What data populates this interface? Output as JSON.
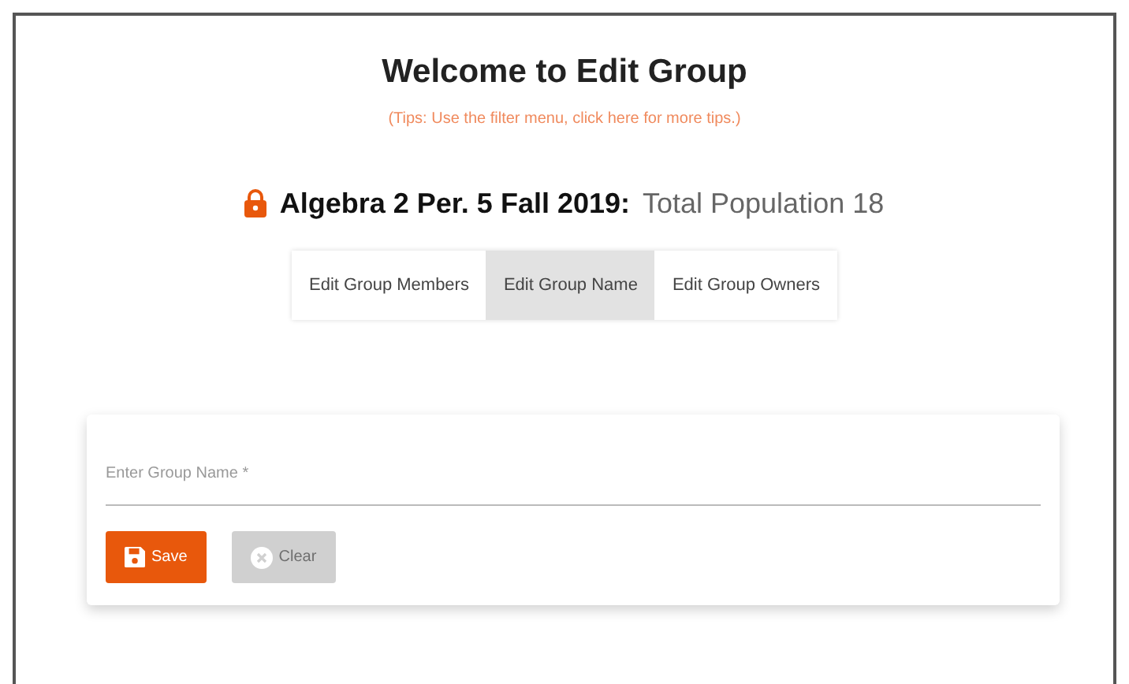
{
  "header": {
    "title": "Welcome to Edit Group",
    "tips": "(Tips: Use the filter menu, click here for more tips.)"
  },
  "group": {
    "name": "Algebra 2 Per. 5 Fall 2019:",
    "population": "Total Population 18",
    "locked": true
  },
  "tabs": [
    {
      "label": "Edit Group Members",
      "selected": false
    },
    {
      "label": "Edit Group Name",
      "selected": true
    },
    {
      "label": "Edit Group Owners",
      "selected": false
    }
  ],
  "form": {
    "field": {
      "placeholder": "Enter Group Name *"
    },
    "buttons": [
      {
        "label": "Save",
        "kind": "save",
        "disabled": false
      },
      {
        "label": "Clear",
        "kind": "clear",
        "disabled": true
      }
    ]
  }
}
